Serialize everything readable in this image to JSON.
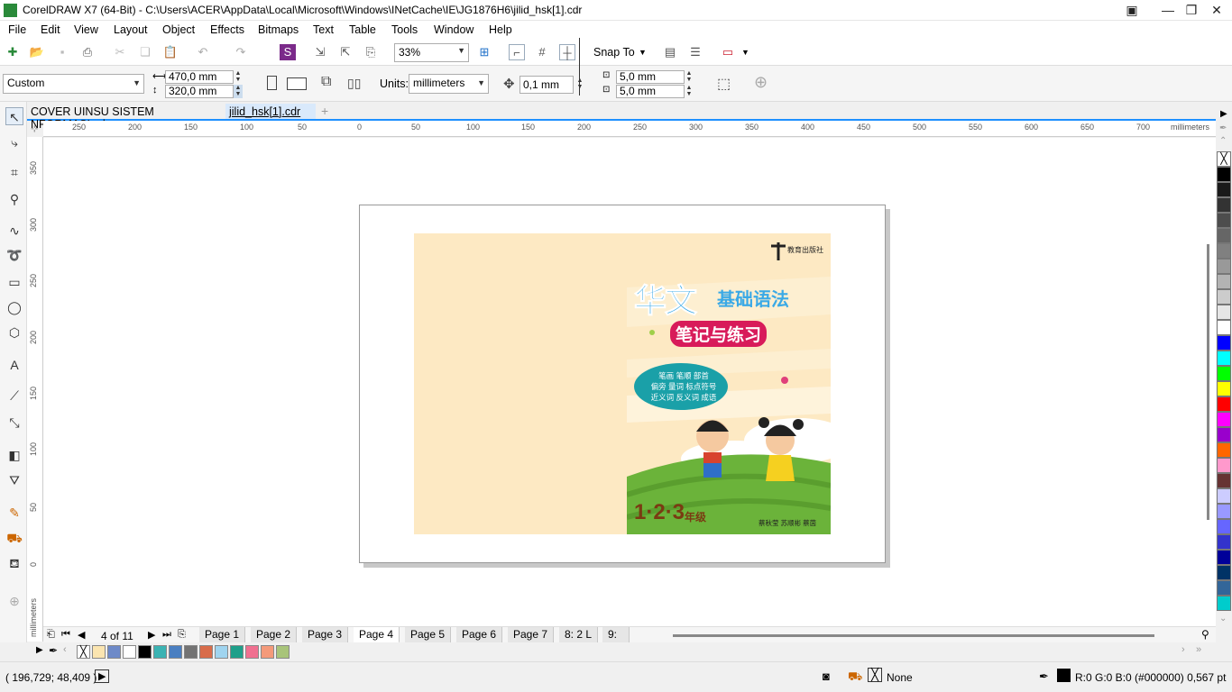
{
  "window": {
    "title": "CorelDRAW X7 (64-Bit) - C:\\Users\\ACER\\AppData\\Local\\Microsoft\\Windows\\INetCache\\IE\\JG1876H6\\jilid_hsk[1].cdr"
  },
  "menu": [
    "File",
    "Edit",
    "View",
    "Layout",
    "Object",
    "Effects",
    "Bitmaps",
    "Text",
    "Table",
    "Tools",
    "Window",
    "Help"
  ],
  "toolbar": {
    "zoom": "33%",
    "snap_to": "Snap To"
  },
  "property_bar": {
    "page_preset": "Custom",
    "width": "470,0 mm",
    "height": "320,0 mm",
    "units_label": "Units:",
    "units": "millimeters",
    "nudge": "0,1 mm",
    "dup_x": "5,0 mm",
    "dup_y": "5,0 mm"
  },
  "doc_tabs": [
    "COVER UINSU SISTEM NFORMASI.cdr",
    "jilid_hsk[1].cdr"
  ],
  "ruler": {
    "h_ticks": [
      "250",
      "200",
      "150",
      "100",
      "50",
      "0",
      "50",
      "100",
      "150",
      "200",
      "250",
      "300",
      "350",
      "400",
      "450",
      "500",
      "550",
      "600",
      "650",
      "700"
    ],
    "h_unit": "millimeters",
    "v_ticks": [
      "350",
      "300",
      "250",
      "200",
      "150",
      "100",
      "50",
      "0"
    ],
    "v_unit": "millimeters"
  },
  "page_nav": {
    "counter": "4 of 11",
    "tabs": [
      "Page 1",
      "Page 2",
      "Page 3",
      "Page 4",
      "Page 5",
      "Page 6",
      "Page 7",
      "8: 2 L",
      "9: "
    ],
    "active": "Page 4"
  },
  "cover": {
    "publisher": "教育出版社",
    "title_big": "华文",
    "title_small": "基础语法",
    "subtitle": "笔记与练习",
    "bubble_line1": "笔画  笔顺  部首",
    "bubble_line2": "偏旁  量词  标点符号",
    "bubble_line3": "近义词  反义词  成语",
    "grade": "1·2·3",
    "grade_suffix": "年级",
    "authors": "蔡秋莹  苏顺彬  蔡茵"
  },
  "status": {
    "coords": "( 196,729; 48,409 )",
    "fill": "None",
    "outline": "R:0 G:0 B:0 (#000000)  0,567 pt"
  },
  "colors": {
    "accent": "#1e90ff",
    "cover_bg": "#fde9c3",
    "grass": "#6bb33a",
    "title_blue": "#3aa9e6",
    "subtitle_red": "#d81b5a"
  },
  "doc_palette": [
    "#ffffff",
    "#fbe5b0",
    "#6e8ac8",
    "#ffffff",
    "#000000",
    "#3bb3b3",
    "#4a7fc1",
    "#737373",
    "#d86c4a",
    "#9fd4ef",
    "#1e9f8a",
    "#f07090",
    "#f49a7a",
    "#a8c47a"
  ],
  "right_palette": [
    "#000000",
    "#1a1a1a",
    "#333333",
    "#4d4d4d",
    "#666666",
    "#808080",
    "#999999",
    "#b3b3b3",
    "#cccccc",
    "#e6e6e6",
    "#ffffff",
    "#0000ff",
    "#00ffff",
    "#00ff00",
    "#ffff00",
    "#ff0000",
    "#ff00ff",
    "#9900cc",
    "#ff6600",
    "#ff99cc",
    "#663333",
    "#ccccff",
    "#9999ff",
    "#6666ff",
    "#3333cc",
    "#000099",
    "#003366",
    "#336699",
    "#00cccc"
  ]
}
